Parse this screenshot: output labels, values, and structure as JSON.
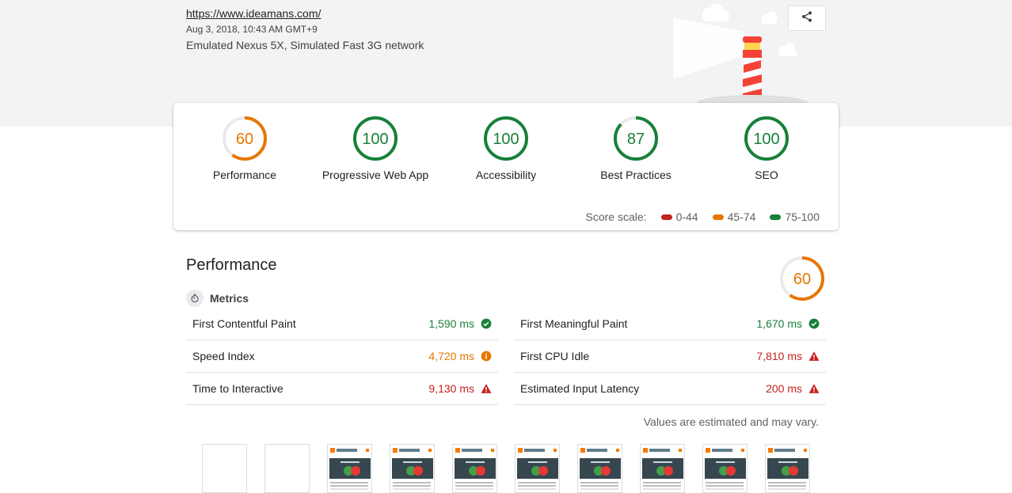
{
  "header": {
    "url": "https://www.ideamans.com/",
    "date": "Aug 3, 2018, 10:43 AM GMT+9",
    "environment": "Emulated Nexus 5X, Simulated Fast 3G network"
  },
  "colors": {
    "fail": "#c5221f",
    "average": "#e67700",
    "pass": "#188038"
  },
  "summary": {
    "gauges": [
      {
        "score": "60",
        "label": "Performance",
        "fraction": 0.6,
        "status": "average"
      },
      {
        "score": "100",
        "label": "Progressive Web App",
        "fraction": 1.0,
        "status": "pass"
      },
      {
        "score": "100",
        "label": "Accessibility",
        "fraction": 1.0,
        "status": "pass"
      },
      {
        "score": "87",
        "label": "Best Practices",
        "fraction": 0.87,
        "status": "pass"
      },
      {
        "score": "100",
        "label": "SEO",
        "fraction": 1.0,
        "status": "pass"
      }
    ],
    "scale_label": "Score scale:",
    "scale": [
      {
        "range": "0-44",
        "status": "fail"
      },
      {
        "range": "45-74",
        "status": "average"
      },
      {
        "range": "75-100",
        "status": "pass"
      }
    ]
  },
  "performance": {
    "title": "Performance",
    "score": "60",
    "fraction": 0.6,
    "metrics_heading": "Metrics",
    "metrics_left": [
      {
        "name": "First Contentful Paint",
        "value": "1,590 ms",
        "status": "pass"
      },
      {
        "name": "Speed Index",
        "value": "4,720 ms",
        "status": "average"
      },
      {
        "name": "Time to Interactive",
        "value": "9,130 ms",
        "status": "fail"
      }
    ],
    "metrics_right": [
      {
        "name": "First Meaningful Paint",
        "value": "1,670 ms",
        "status": "pass"
      },
      {
        "name": "First CPU Idle",
        "value": "7,810 ms",
        "status": "fail"
      },
      {
        "name": "Estimated Input Latency",
        "value": "200 ms",
        "status": "fail"
      }
    ],
    "note": "Values are estimated and may vary."
  },
  "filmstrip": [
    "blank",
    "blank",
    "loaded",
    "loaded",
    "loaded",
    "loaded",
    "loaded",
    "loaded",
    "loaded",
    "loaded"
  ],
  "icons": {
    "share": "share-icon",
    "metrics": "timer-icon",
    "pass": "check-circle-icon",
    "average": "info-circle-icon",
    "fail": "warning-triangle-icon"
  }
}
